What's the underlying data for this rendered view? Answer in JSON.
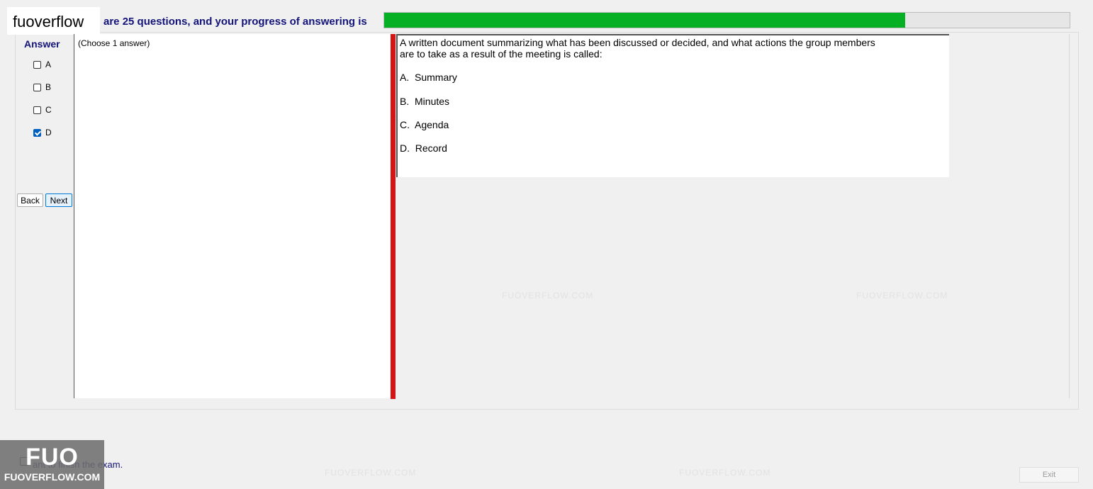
{
  "brand": {
    "name": "fuoverflow"
  },
  "header": {
    "text": "are 25 questions, and your progress of answering is",
    "progress": 0.76,
    "progress_color": "#06b025"
  },
  "answer_panel": {
    "title": "Answer",
    "options": [
      {
        "label": "A",
        "checked": false
      },
      {
        "label": "B",
        "checked": false
      },
      {
        "label": "C",
        "checked": false
      },
      {
        "label": "D",
        "checked": true
      }
    ],
    "back_label": "Back",
    "next_label": "Next"
  },
  "choose_label": "(Choose 1 answer)",
  "question": {
    "line1": "A written document summarizing what has been discussed or decided, and what actions the group members",
    "line2": "are to take as a result of the meeting is called:",
    "choices": [
      {
        "letter": "A.",
        "text": "Summary"
      },
      {
        "letter": "B.",
        "text": "Minutes"
      },
      {
        "letter": "C.",
        "text": "Agenda"
      },
      {
        "letter": "D.",
        "text": "Record"
      }
    ]
  },
  "footer": {
    "finish_text": "ant to finish the exam.",
    "exit_label": "Exit"
  },
  "logo": {
    "big": "FUO",
    "small": "FUOVERFLOW.COM"
  },
  "watermark": "FUOVERFLOW.COM",
  "colors": {
    "splitter": "#d31515",
    "header_text": "#14147a"
  }
}
